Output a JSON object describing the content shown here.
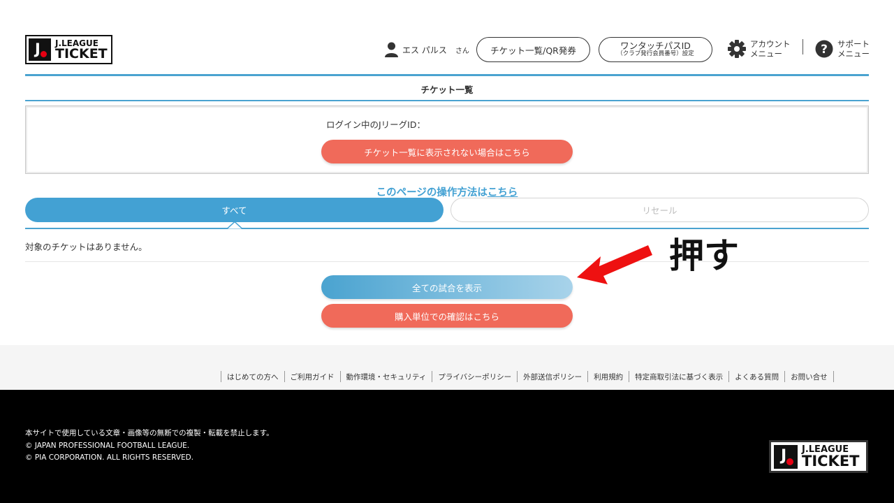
{
  "header": {
    "logo_line1": "J.LEAGUE",
    "logo_line2": "TICKET",
    "user_name": "エス パルス",
    "user_suffix": "さん",
    "ticket_list_button": "チケット一覧/QR発券",
    "onetouch_button_line1": "ワンタッチパスID",
    "onetouch_button_line2": "（クラブ発行会員番号）設定",
    "account_menu_line1": "アカウント",
    "account_menu_line2": "メニュー",
    "support_menu_line1": "サポート",
    "support_menu_line2": "メニュー"
  },
  "page": {
    "title": "チケット一覧",
    "login_id_label": "ログイン中のJリーグID：",
    "not_shown_button": "チケット一覧に表示されない場合はこちら",
    "howto_text": "このページの操作方法は",
    "howto_link": "こちら"
  },
  "tabs": {
    "all": "すべて",
    "resale": "リセール"
  },
  "main": {
    "no_tickets": "対象のチケットはありません。",
    "show_all_matches_button": "全ての試合を表示",
    "purchase_unit_button": "購入単位での確認はこちら"
  },
  "annotation": {
    "text": "押す",
    "arrow_color": "#ee1111"
  },
  "footer": {
    "links": [
      "はじめての方へ",
      "ご利用ガイド",
      "動作環境・セキュリティ",
      "プライバシーポリシー",
      "外部送信ポリシー",
      "利用規約",
      "特定商取引法に基づく表示",
      "よくある質問",
      "お問い合せ"
    ],
    "copyright_line1": "本サイトで使用している文章・画像等の無断での複製・転載を禁止します。",
    "copyright_line2": "© JAPAN PROFESSIONAL FOOTBALL LEAGUE.",
    "copyright_line3": "© PIA CORPORATION. ALL RIGHTS RESERVED.",
    "logo_line1": "J.LEAGUE",
    "logo_line2": "TICKET"
  },
  "colors": {
    "accent_blue": "#43a1d3",
    "coral": "#f06a5a",
    "footer_bg": "#000000",
    "footer_links_bg": "#f5f5f5"
  }
}
